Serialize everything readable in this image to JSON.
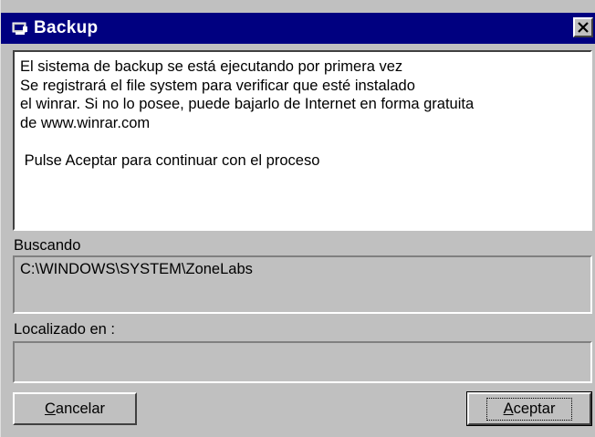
{
  "window": {
    "title": "Backup"
  },
  "message": {
    "lines": [
      "El sistema de backup se está ejecutando por primera vez",
      "Se registrará el file system para verificar que esté instalado",
      "el winrar. Si no lo posee, puede bajarlo de Internet en forma gratuita",
      "de www.winrar.com",
      "",
      " Pulse Aceptar para continuar con el proceso"
    ]
  },
  "search": {
    "label": "Buscando",
    "value": "C:\\WINDOWS\\SYSTEM\\ZoneLabs"
  },
  "located": {
    "label": "Localizado en :",
    "value": ""
  },
  "buttons": {
    "cancel_mnemonic": "C",
    "cancel_rest": "ancelar",
    "accept_mnemonic": "A",
    "accept_rest": "ceptar"
  },
  "colors": {
    "titlebar": "#000080",
    "face": "#c0c0c0"
  }
}
